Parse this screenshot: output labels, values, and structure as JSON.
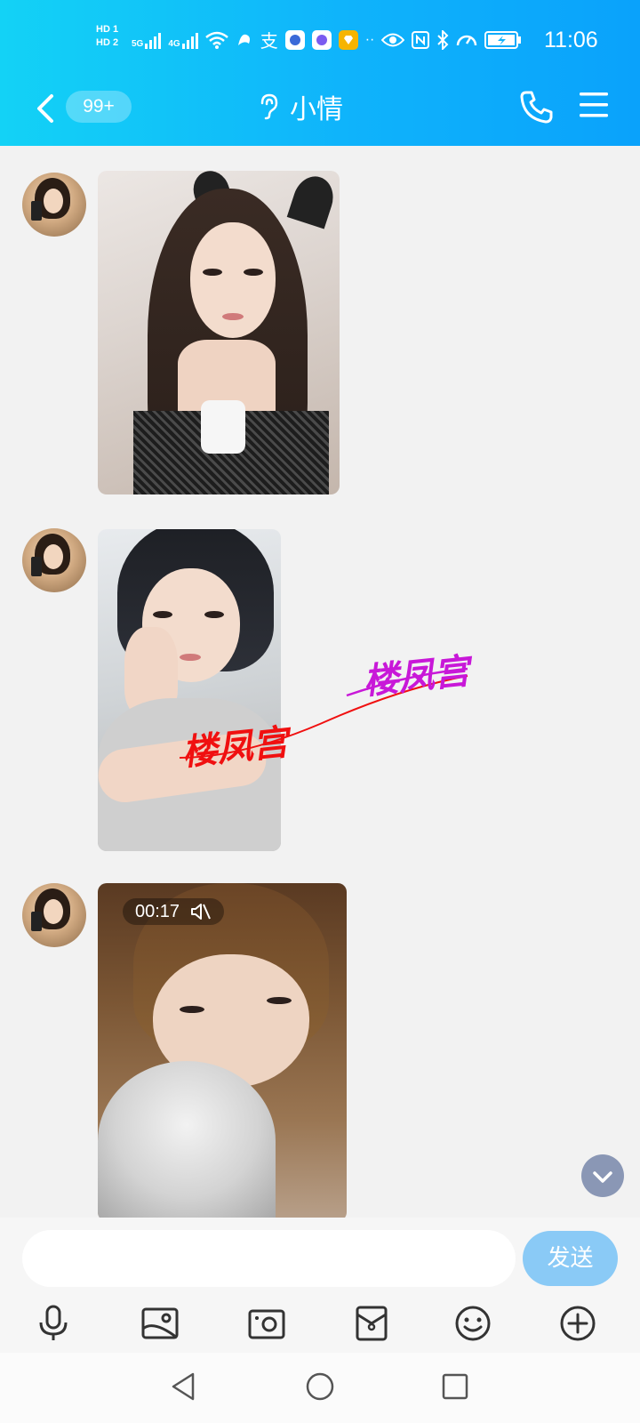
{
  "status_bar": {
    "hd_labels": [
      "HD 1",
      "HD 2"
    ],
    "network_labels": [
      "5G",
      "4G"
    ],
    "time": "11:06",
    "icons": [
      "wifi-icon",
      "notification-icon",
      "alipay-icon",
      "app-icon",
      "music-icon",
      "app-icon",
      "eye-icon",
      "nfc-icon",
      "bluetooth-icon",
      "speed-icon",
      "battery-charging-icon"
    ]
  },
  "header": {
    "back_badge": "99+",
    "title": "小情"
  },
  "chat": {
    "messages": [
      {
        "type": "image",
        "watermarks": []
      },
      {
        "type": "image",
        "watermarks": [
          "楼凤宫",
          "楼凤宫"
        ]
      },
      {
        "type": "video",
        "duration": "00:17",
        "muted": true
      }
    ]
  },
  "composer": {
    "input_value": "",
    "send_label": "发送",
    "tools": [
      "microphone-icon",
      "image-icon",
      "camera-icon",
      "red-packet-icon",
      "emoji-icon",
      "plus-icon"
    ]
  },
  "colors": {
    "header_start": "#13d2f6",
    "header_end": "#0aa2fb",
    "send_button": "#8acaf6",
    "watermark_red": "#f01010",
    "watermark_pink": "#c818d8"
  }
}
